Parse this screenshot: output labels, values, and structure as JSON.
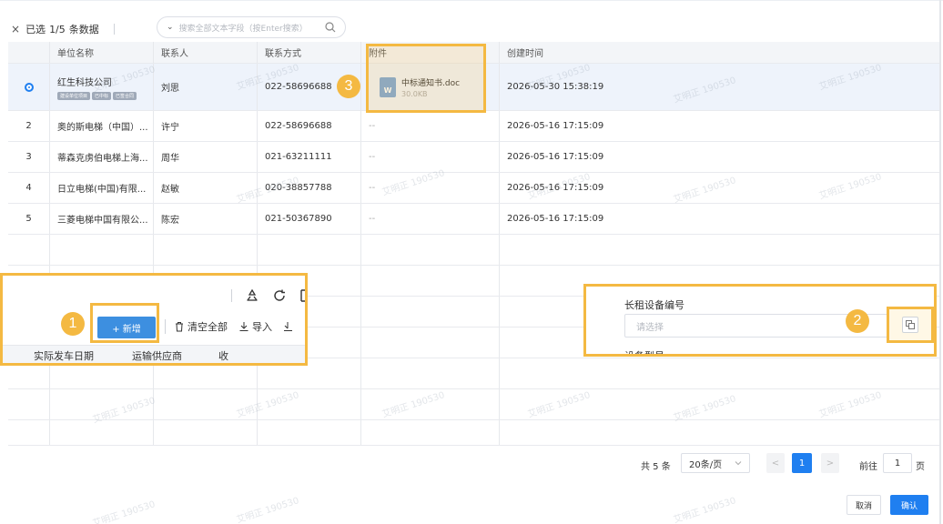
{
  "selection": {
    "close_glyph": "×",
    "label": "已选",
    "count": "1/5",
    "suffix": "条数据"
  },
  "search": {
    "placeholder": "搜索全部文本字段（按Enter搜索）",
    "chevron_glyph": "⌄"
  },
  "table": {
    "headers": [
      "单位名称",
      "联系人",
      "联系方式",
      "附件",
      "创建时间"
    ],
    "rows": [
      {
        "index": "",
        "unit": "红生科技公司",
        "tags": [
          "建设单位项目",
          "已中标",
          "已签合同"
        ],
        "contact": "刘思",
        "phone": "022-58696688",
        "attachment": {
          "name": "中标通知书.doc",
          "size": "30.0KB",
          "icon_letter": "W"
        },
        "created": "2026-05-30 15:38:19"
      },
      {
        "index": "2",
        "unit": "奥的斯电梯（中国）...",
        "contact": "许宁",
        "phone": "022-58696688",
        "attachment_text": "--",
        "created": "2026-05-16 17:15:09"
      },
      {
        "index": "3",
        "unit": "蒂森克虏伯电梯上海...",
        "contact": "周华",
        "phone": "021-63211111",
        "attachment_text": "--",
        "created": "2026-05-16 17:15:09"
      },
      {
        "index": "4",
        "unit": "日立电梯(中国)有限...",
        "contact": "赵敏",
        "phone": "020-38857788",
        "attachment_text": "--",
        "created": "2026-05-16 17:15:09"
      },
      {
        "index": "5",
        "unit": "三菱电梯中国有限公...",
        "contact": "陈宏",
        "phone": "021-50367890",
        "attachment_text": "--",
        "created": "2026-05-16 17:15:09"
      }
    ]
  },
  "panel1": {
    "badge": "1",
    "add_button": "+ 新增",
    "clear_all": "清空全部",
    "import": "导入",
    "col_headers": [
      "实际发车日期",
      "运输供应商",
      "收"
    ]
  },
  "panel2": {
    "badge": "2",
    "label": "长租设备编号",
    "placeholder": "请选择",
    "label2": "设备型号"
  },
  "badge3": "3",
  "pagination": {
    "total": "共 5 条",
    "page_size": "20条/页",
    "current_page": "1",
    "goto_label": "前往",
    "goto_value": "1",
    "page_suffix": "页",
    "prev_glyph": "<",
    "next_glyph": ">"
  },
  "footer": {
    "cancel": "取消",
    "confirm": "确认"
  },
  "watermark": "艾明正 190530",
  "colors": {
    "accent": "#1f7ff0",
    "highlight": "#f4b942",
    "add_button": "#3d8fe0"
  }
}
